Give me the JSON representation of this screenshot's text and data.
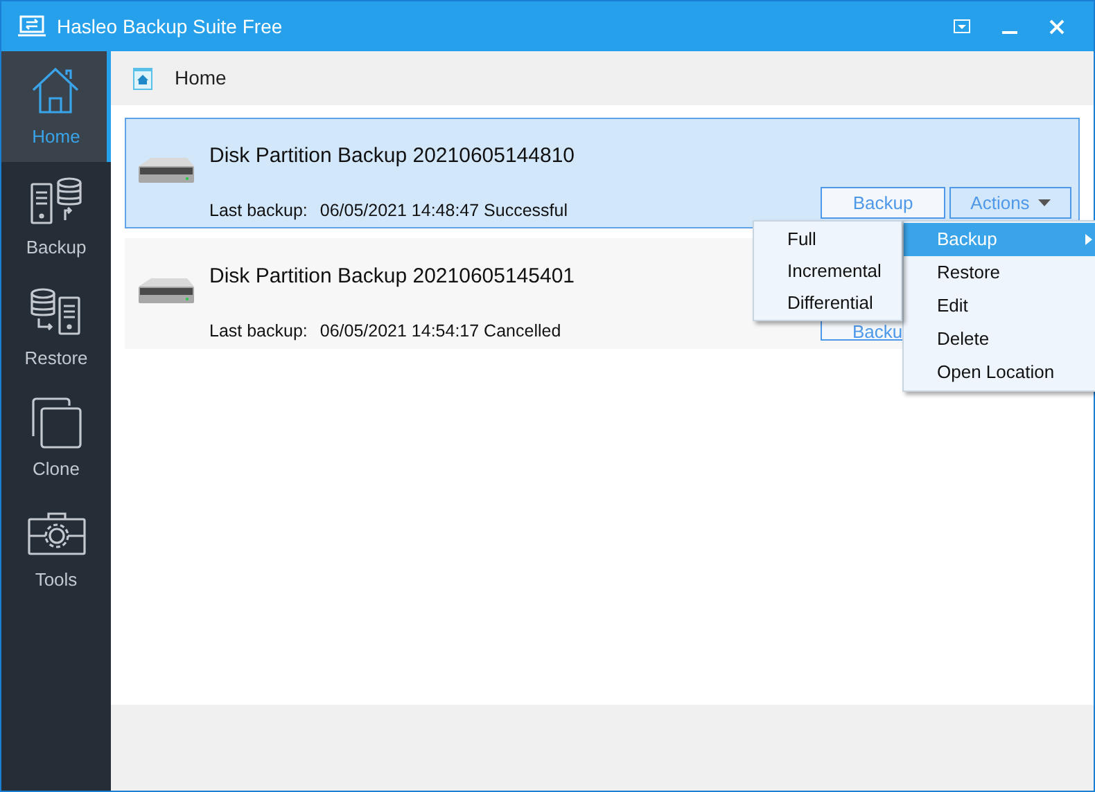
{
  "window": {
    "title": "Hasleo Backup Suite Free"
  },
  "sidebar": {
    "items": [
      {
        "label": "Home",
        "selected": true
      },
      {
        "label": "Backup",
        "selected": false
      },
      {
        "label": "Restore",
        "selected": false
      },
      {
        "label": "Clone",
        "selected": false
      },
      {
        "label": "Tools",
        "selected": false
      }
    ]
  },
  "breadcrumb": "Home",
  "backups": [
    {
      "name": "Disk Partition Backup 20210605144810",
      "last_label": "Last backup:",
      "last_value": "06/05/2021 14:48:47 Successful",
      "selected": true,
      "backup_button": "Backup",
      "actions_button": "Actions"
    },
    {
      "name": "Disk Partition Backup 20210605145401",
      "last_label": "Last backup:",
      "last_value": "06/05/2021 14:54:17 Cancelled",
      "selected": false,
      "backup_button": "Backu"
    }
  ],
  "actions_menu": [
    {
      "label": "Backup",
      "selected": true,
      "has_submenu": true
    },
    {
      "label": "Restore",
      "selected": false,
      "has_submenu": false
    },
    {
      "label": "Edit",
      "selected": false,
      "has_submenu": false
    },
    {
      "label": "Delete",
      "selected": false,
      "has_submenu": false
    },
    {
      "label": "Open Location",
      "selected": false,
      "has_submenu": false
    }
  ],
  "backup_submenu": [
    {
      "label": "Full"
    },
    {
      "label": "Incremental"
    },
    {
      "label": "Differential"
    }
  ]
}
